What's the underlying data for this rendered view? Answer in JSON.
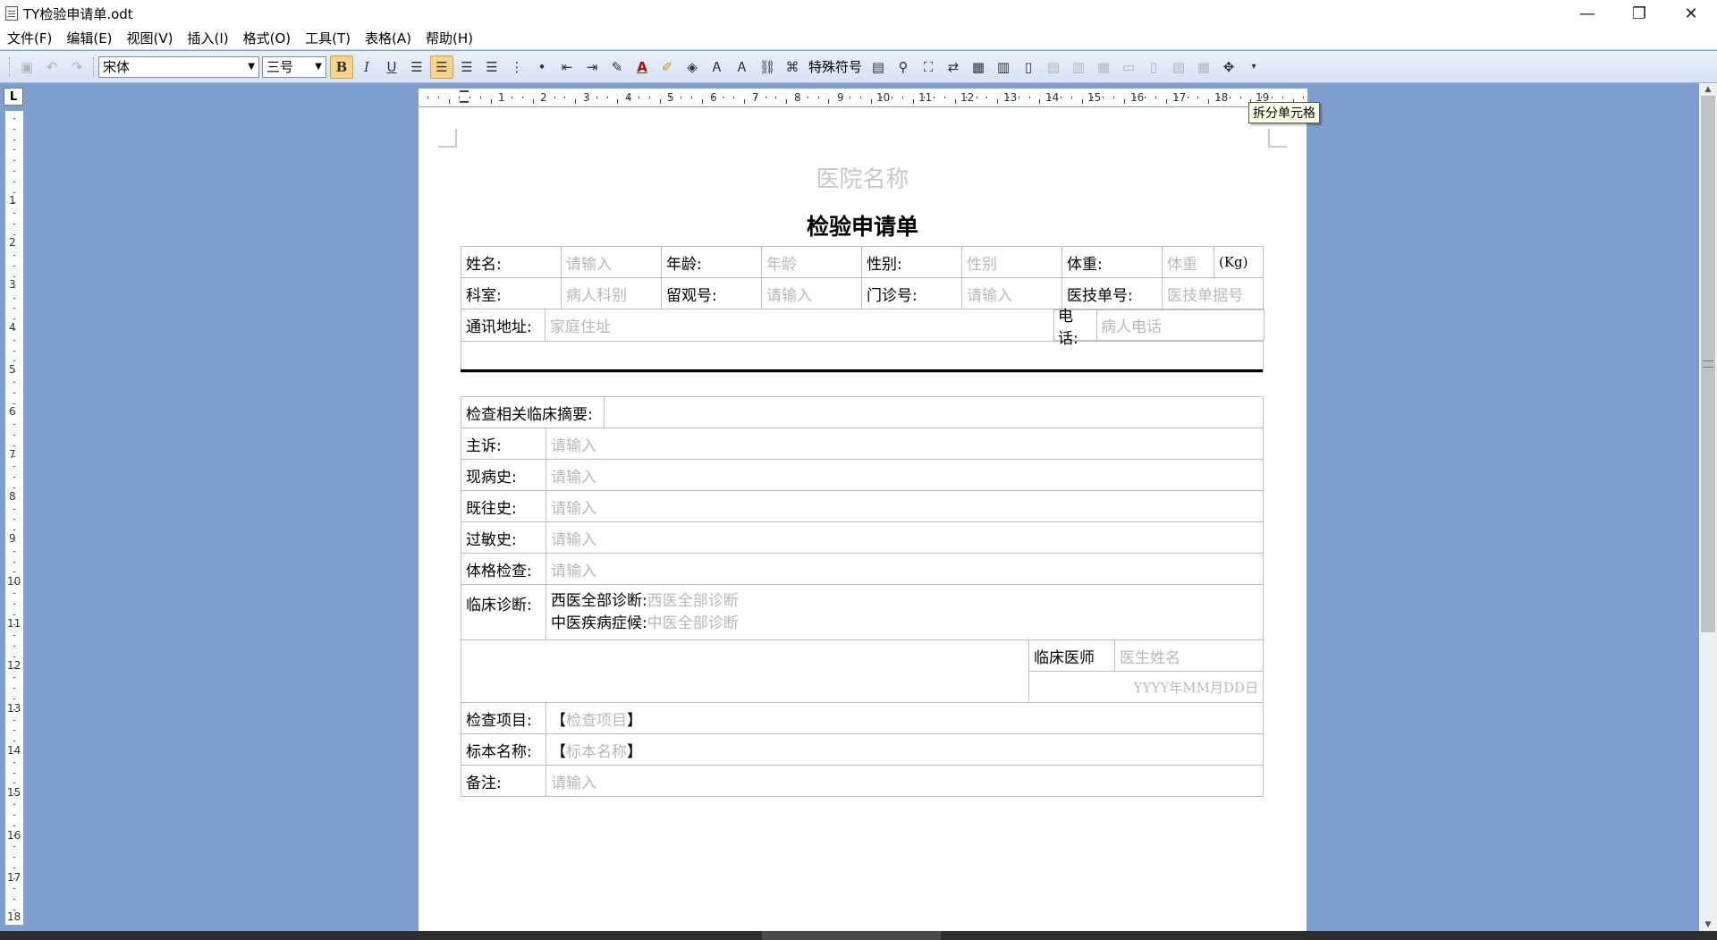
{
  "window": {
    "title": "TY检验申请单.odt",
    "minimize": "—",
    "restore": "❐",
    "close": "✕"
  },
  "menu": [
    "文件(F)",
    "编辑(E)",
    "视图(V)",
    "插入(I)",
    "格式(O)",
    "工具(T)",
    "表格(A)",
    "帮助(H)"
  ],
  "toolbar": {
    "font_name": "宋体",
    "font_size": "三号",
    "bold": "B",
    "italic": "I",
    "underline": "U",
    "special_chars": "特殊符号"
  },
  "ruler": {
    "corner": "L",
    "h_numbers": [
      "1",
      "2",
      "3",
      "4",
      "5",
      "6",
      "7",
      "8",
      "9",
      "10",
      "11",
      "12",
      "13",
      "14",
      "15",
      "16",
      "17",
      "18",
      "19"
    ],
    "v_numbers": [
      "1",
      "2",
      "3",
      "4",
      "5",
      "6",
      "7",
      "8",
      "9",
      "10",
      "11",
      "12",
      "13",
      "14",
      "15",
      "16",
      "17",
      "18"
    ]
  },
  "tooltip": "拆分单元格",
  "document": {
    "hospital_name": "医院名称",
    "form_title": "检验申请单",
    "patient": {
      "name_label": "姓名:",
      "name_ph": "请输入",
      "age_label": "年龄:",
      "age_ph": "年龄",
      "sex_label": "性别:",
      "sex_ph": "性别",
      "weight_label": "体重:",
      "weight_ph": "体重",
      "weight_unit": "(Kg)",
      "dept_label": "科室:",
      "dept_ph": "病人科别",
      "obs_label": "留观号:",
      "obs_ph": "请输入",
      "clinic_label": "门诊号:",
      "clinic_ph": "请输入",
      "tech_label": "医技单号:",
      "tech_ph": "医技单据号",
      "address_label": "通讯地址:",
      "address_ph": "家庭住址",
      "phone_label": "电话:",
      "phone_ph": "病人电话"
    },
    "clinical": {
      "summary_label": "检查相关临床摘要:",
      "complaint_label": "主诉:",
      "complaint_ph": "请输入",
      "present_label": "现病史:",
      "present_ph": "请输入",
      "past_label": "既往史:",
      "past_ph": "请输入",
      "allergy_label": "过敏史:",
      "allergy_ph": "请输入",
      "exam_label": "体格检查:",
      "exam_ph": "请输入",
      "diag_label": "临床诊断:",
      "western_label": "西医全部诊断:",
      "western_ph": "西医全部诊断",
      "tcm_label": "中医疾病症候:",
      "tcm_ph": "中医全部诊断",
      "doctor_label": "临床医师",
      "doctor_ph": "医生姓名",
      "date_text": "YYYY年MM月DD日",
      "item_label": "检查项目:",
      "item_open": "【",
      "item_ph": "检查项目",
      "item_close": "】",
      "specimen_label": "标本名称:",
      "specimen_open": "【",
      "specimen_ph": "标本名称",
      "specimen_close": "】",
      "note_label": "备注:",
      "note_ph": "请输入"
    }
  }
}
